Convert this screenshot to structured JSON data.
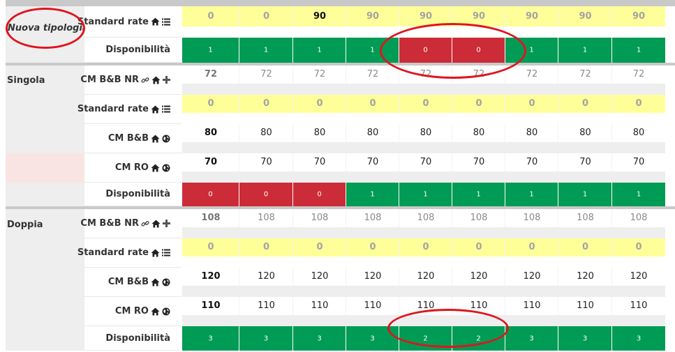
{
  "columns": 9,
  "colors": {
    "available": "#009b55",
    "unavailable": "#cc2c37",
    "standard_rate": "#ffff99",
    "row_type_bg": "#eeeeee"
  },
  "sections": [
    {
      "type_name": "Nuova tipologia",
      "rows": [
        {
          "label": "Standard rate",
          "icons": [
            "home-icon",
            "list-icon"
          ],
          "style": "yellow",
          "values": [
            "0",
            "0",
            "90",
            "90",
            "90",
            "90",
            "90",
            "90",
            "90"
          ]
        },
        {
          "label": "Disponibilità",
          "icons": [],
          "style": "availability",
          "values": [
            "1",
            "1",
            "1",
            "1",
            "0",
            "0",
            "1",
            "1",
            "1"
          ]
        }
      ]
    },
    {
      "type_name": "Singola",
      "rows": [
        {
          "label": "CM B&B NR",
          "icons": [
            "link-icon",
            "home-icon",
            "plus-icon"
          ],
          "style": "grey-text",
          "values": [
            "72",
            "72",
            "72",
            "72",
            "72",
            "72",
            "72",
            "72",
            "72"
          ]
        },
        {
          "label": "Standard rate",
          "icons": [
            "home-icon",
            "list-icon"
          ],
          "style": "yellow",
          "values": [
            "0",
            "0",
            "0",
            "0",
            "0",
            "0",
            "0",
            "0",
            "0"
          ]
        },
        {
          "label": "CM B&B",
          "icons": [
            "home-icon",
            "globe-icon"
          ],
          "style": "white",
          "values": [
            "80",
            "80",
            "80",
            "80",
            "80",
            "80",
            "80",
            "80",
            "80"
          ]
        },
        {
          "label": "CM RO",
          "icons": [
            "home-icon",
            "globe-icon"
          ],
          "style": "white",
          "values": [
            "70",
            "70",
            "70",
            "70",
            "70",
            "70",
            "70",
            "70",
            "70"
          ]
        },
        {
          "label": "Disponibilità",
          "icons": [],
          "style": "availability",
          "values": [
            "0",
            "0",
            "0",
            "1",
            "1",
            "1",
            "1",
            "1",
            "1"
          ]
        }
      ]
    },
    {
      "type_name": "Doppia",
      "rows": [
        {
          "label": "CM B&B NR",
          "icons": [
            "link-icon",
            "home-icon",
            "plus-icon"
          ],
          "style": "grey-text",
          "values": [
            "108",
            "108",
            "108",
            "108",
            "108",
            "108",
            "108",
            "108",
            "108"
          ]
        },
        {
          "label": "Standard rate",
          "icons": [
            "home-icon",
            "list-icon"
          ],
          "style": "yellow",
          "values": [
            "0",
            "0",
            "0",
            "0",
            "0",
            "0",
            "0",
            "0",
            "0"
          ]
        },
        {
          "label": "CM B&B",
          "icons": [
            "home-icon",
            "globe-icon"
          ],
          "style": "white",
          "values": [
            "120",
            "120",
            "120",
            "120",
            "120",
            "120",
            "120",
            "120",
            "120"
          ]
        },
        {
          "label": "CM RO",
          "icons": [
            "home-icon",
            "globe-icon"
          ],
          "style": "white",
          "values": [
            "110",
            "110",
            "110",
            "110",
            "110",
            "110",
            "110",
            "110",
            "110"
          ]
        },
        {
          "label": "Disponibilità",
          "icons": [],
          "style": "availability",
          "values": [
            "3",
            "3",
            "3",
            "3",
            "2",
            "2",
            "3",
            "3",
            "3"
          ]
        }
      ]
    }
  ]
}
